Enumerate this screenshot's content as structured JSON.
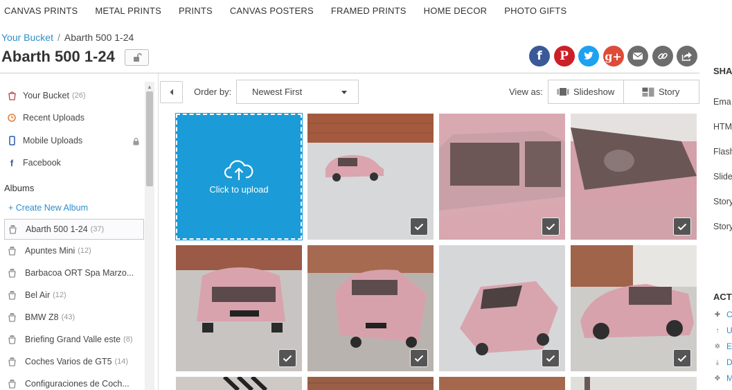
{
  "nav": [
    "CANVAS PRINTS",
    "METAL PRINTS",
    "PRINTS",
    "CANVAS POSTERS",
    "FRAMED PRINTS",
    "HOME DECOR",
    "PHOTO GIFTS"
  ],
  "breadcrumb": {
    "root": "Your Bucket",
    "sep": "/",
    "current": "Abarth 500 1-24"
  },
  "title": "Abarth 500 1-24",
  "share_buttons": [
    {
      "name": "facebook",
      "glyph": "f",
      "color": "#3b5998"
    },
    {
      "name": "pinterest",
      "glyph": "P",
      "color": "#cb2027"
    },
    {
      "name": "twitter",
      "glyph": "t",
      "color": "#1da1f2"
    },
    {
      "name": "google-plus",
      "glyph": "g+",
      "color": "#dd4b39"
    },
    {
      "name": "email",
      "glyph": "",
      "color": "#6d6d6d"
    },
    {
      "name": "link",
      "glyph": "",
      "color": "#6d6d6d"
    },
    {
      "name": "share",
      "glyph": "",
      "color": "#6d6d6d"
    }
  ],
  "sidebar": {
    "items": [
      {
        "label": "Your Bucket",
        "count": "(26)",
        "icon": "bucket-icon"
      },
      {
        "label": "Recent Uploads",
        "count": "",
        "icon": "clock-icon"
      },
      {
        "label": "Mobile Uploads",
        "count": "",
        "icon": "phone-icon"
      },
      {
        "label": "Facebook",
        "count": "",
        "icon": "facebook-icon"
      }
    ],
    "albums_heading": "Albums",
    "create_album": "+ Create New Album",
    "albums": [
      {
        "label": "Abarth 500 1-24",
        "count": "(37)",
        "active": true
      },
      {
        "label": "Apuntes Mini",
        "count": "(12)"
      },
      {
        "label": "Barbacoa ORT Spa Marzo...",
        "count": ""
      },
      {
        "label": "Bel Air",
        "count": "(12)"
      },
      {
        "label": "BMW Z8",
        "count": "(43)"
      },
      {
        "label": "Briefing Grand Valle este",
        "count": "(8)"
      },
      {
        "label": "Coches Varios de GT5",
        "count": "(14)"
      },
      {
        "label": "Configuraciones de Coch...",
        "count": ""
      }
    ]
  },
  "toolbar": {
    "order_label": "Order by:",
    "order_value": "Newest First",
    "view_label": "View as:",
    "slideshow": "Slideshow",
    "story": "Story"
  },
  "upload_label": "Click to upload",
  "right_panel": {
    "share_heading": "SHA",
    "share_items": [
      "Ema",
      "HTM",
      "Flash",
      "Slide",
      "Story",
      "Story"
    ],
    "actions_heading": "ACT",
    "actions": [
      "C",
      "U",
      "E",
      "D",
      "M"
    ]
  },
  "colors": {
    "accent": "#2d8ec9",
    "upload_tile": "#1b9bd7",
    "car_pink": "#d9a3ad"
  }
}
